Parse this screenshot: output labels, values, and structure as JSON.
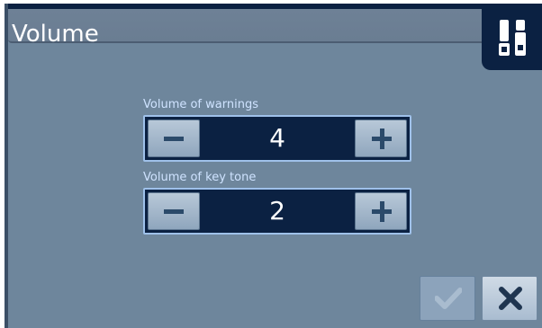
{
  "window": {
    "title": "Volume"
  },
  "header": {
    "corner_icon": "settings-sliders-icon"
  },
  "settings": {
    "warnings": {
      "label": "Volume of warnings",
      "value": "4",
      "decrement_icon": "minus-icon",
      "increment_icon": "plus-icon"
    },
    "key_tone": {
      "label": "Volume of key tone",
      "value": "2",
      "decrement_icon": "minus-icon",
      "increment_icon": "plus-icon"
    }
  },
  "actions": {
    "confirm_icon": "checkmark-icon",
    "cancel_icon": "close-icon"
  },
  "colors": {
    "panel_background": "#6e869c",
    "dark_navy": "#0b2142",
    "label_text": "#cfe3ff",
    "stepper_border": "#9fc1ea",
    "button_gray": "#b8c8d8"
  }
}
